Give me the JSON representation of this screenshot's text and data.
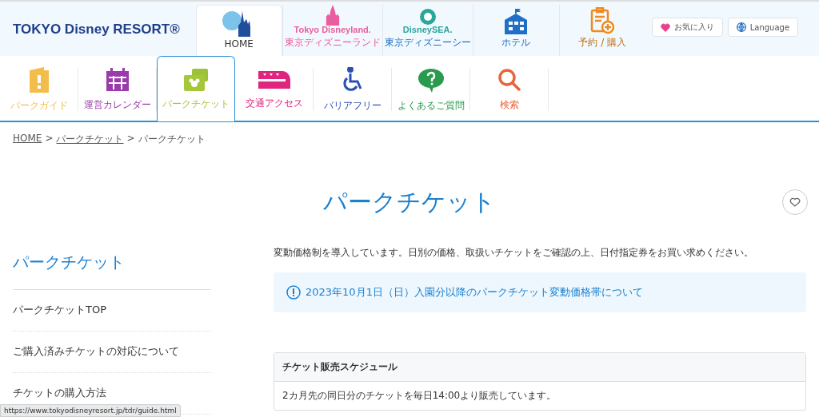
{
  "header": {
    "logo": "TOKYO Disney RESORT®",
    "park_tabs": [
      {
        "kind": "home",
        "label": "HOME",
        "selected": true
      },
      {
        "kind": "land",
        "logo": "Tokyo Disneyland.",
        "label": "東京ディズニーランド",
        "selected": false
      },
      {
        "kind": "sea",
        "logo": "DisneySEA.",
        "label": "東京ディズニーシー",
        "selected": false
      },
      {
        "kind": "hotel",
        "label": "ホテル",
        "selected": false
      },
      {
        "kind": "booking",
        "label": "予約 / 購入",
        "selected": false
      }
    ],
    "favorites_button": "お気に入り",
    "language_button": "Language"
  },
  "nav": [
    {
      "kind": "guide",
      "label": "パークガイド",
      "color": "#f2bd4a",
      "selected": false
    },
    {
      "kind": "calendar",
      "label": "運営カレンダー",
      "color": "#9b3aaa",
      "selected": false
    },
    {
      "kind": "ticket",
      "label": "パークチケット",
      "color": "#a6c73a",
      "selected": true
    },
    {
      "kind": "train",
      "label": "交通アクセス",
      "color": "#e0257e",
      "selected": false
    },
    {
      "kind": "barrier",
      "label": "バリアフリー",
      "color": "#2d4fb5",
      "selected": false
    },
    {
      "kind": "faq",
      "label": "よくあるご質問",
      "color": "#2a9a4e",
      "selected": false
    },
    {
      "kind": "search",
      "label": "検索",
      "color": "#e8643a",
      "selected": false
    }
  ],
  "breadcrumb_separator": ">",
  "breadcrumb": [
    {
      "label": "HOME",
      "link": true
    },
    {
      "label": "パークチケット",
      "link": true
    },
    {
      "label": "パークチケット",
      "link": false
    }
  ],
  "page_title": "パークチケット",
  "sidebar": {
    "title": "パークチケット",
    "items": [
      "パークチケットTOP",
      "ご購入済みチケットの対応について",
      "チケットの購入方法"
    ]
  },
  "intro": "変動価格制を導入しています。日別の価格、取扱いチケットをご確認の上、日付指定券をお買い求めください。",
  "notice": "2023年10月1日（日）入園分以降のパークチケット変動価格帯について",
  "schedule": {
    "title": "チケット販売スケジュール",
    "text": "2カ月先の同日分のチケットを毎日14:00より販売しています。"
  },
  "status_bar": "https://www.tokyodisneyresort.jp/tdr/guide.html"
}
